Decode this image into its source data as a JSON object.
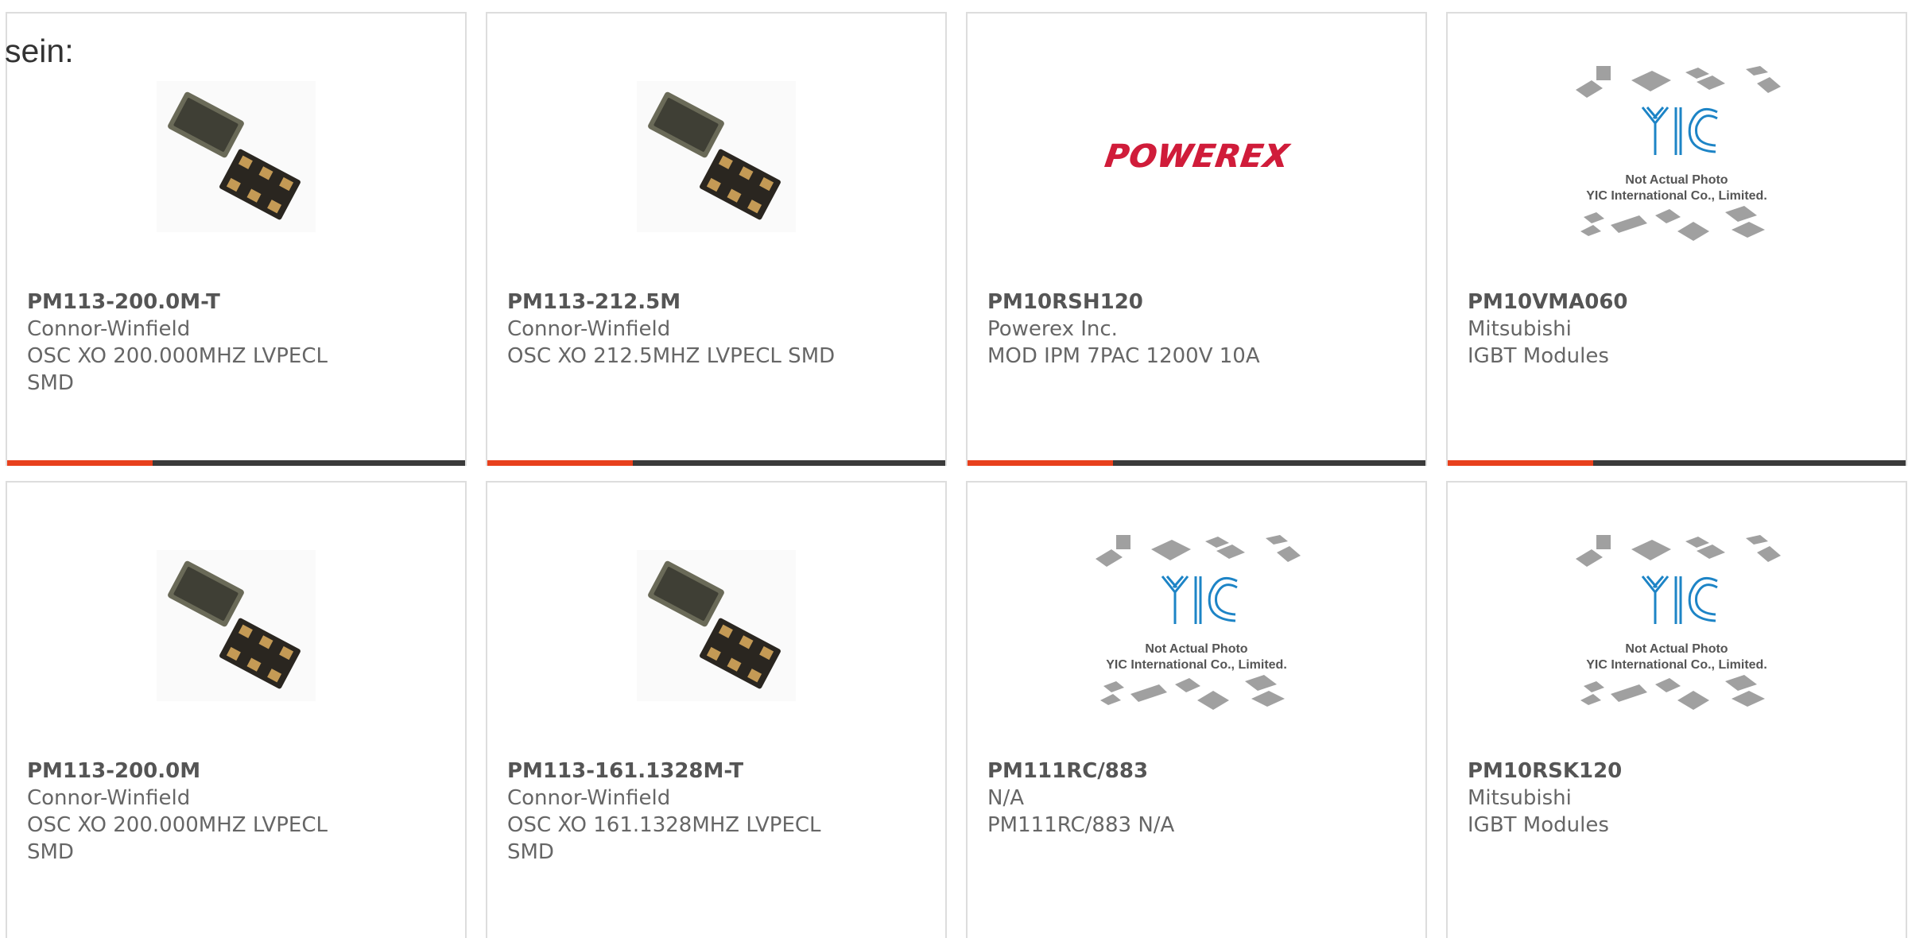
{
  "header": {
    "label": "sein:"
  },
  "products": [
    {
      "part": "PM113-200.0M-T",
      "maker": "Connor-Winfield",
      "desc": "OSC XO 200.000MHZ LVPECL SMD",
      "image": "crystal-oscillator-photo"
    },
    {
      "part": "PM113-212.5M",
      "maker": "Connor-Winfield",
      "desc": "OSC XO 212.5MHZ LVPECL SMD",
      "image": "crystal-oscillator-photo"
    },
    {
      "part": "PM10RSH120",
      "maker": "Powerex Inc.",
      "desc": "MOD IPM 7PAC 1200V 10A",
      "image": "powerex-logo",
      "logo_text": "POWEREX"
    },
    {
      "part": "PM10VMA060",
      "maker": "Mitsubishi",
      "desc": "IGBT Modules",
      "image": "yic-placeholder"
    },
    {
      "part": "PM113-200.0M",
      "maker": "Connor-Winfield",
      "desc": "OSC XO 200.000MHZ LVPECL SMD",
      "image": "crystal-oscillator-photo"
    },
    {
      "part": "PM113-161.1328M-T",
      "maker": "Connor-Winfield",
      "desc": "OSC XO 161.1328MHZ LVPECL SMD",
      "image": "crystal-oscillator-photo"
    },
    {
      "part": "PM111RC/883",
      "maker": "N/A",
      "desc": "PM111RC/883 N/A",
      "image": "yic-placeholder"
    },
    {
      "part": "PM10RSK120",
      "maker": "Mitsubishi",
      "desc": "IGBT Modules",
      "image": "yic-placeholder"
    }
  ],
  "placeholder": {
    "logo": "YIC",
    "line1": "Not Actual Photo",
    "line2": "YIC International Co., Limited."
  },
  "colors": {
    "accent": "#e8401c",
    "bar": "#3a3a3a",
    "text": "#666666",
    "powerex_red": "#d01c3a",
    "yic_blue": "#1d84c6"
  }
}
